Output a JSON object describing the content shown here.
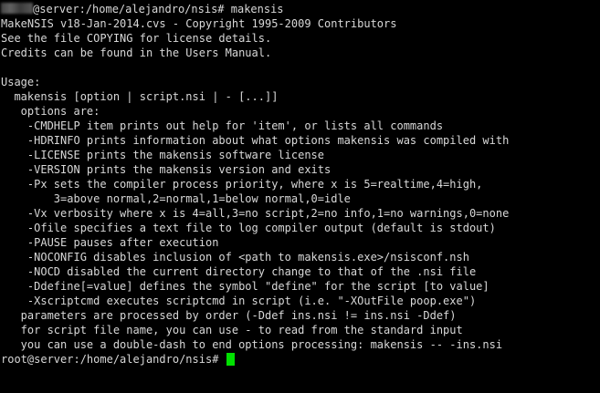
{
  "terminal": {
    "first_prompt": "@server:/home/alejandro/nsis# makensis",
    "output": [
      "MakeNSIS v18-Jan-2014.cvs - Copyright 1995-2009 Contributors",
      "See the file COPYING for license details.",
      "Credits can be found in the Users Manual.",
      "",
      "Usage:",
      "  makensis [option | script.nsi | - [...]]",
      "   options are:",
      "    -CMDHELP item prints out help for 'item', or lists all commands",
      "    -HDRINFO prints information about what options makensis was compiled with",
      "    -LICENSE prints the makensis software license",
      "    -VERSION prints the makensis version and exits",
      "    -Px sets the compiler process priority, where x is 5=realtime,4=high,",
      "        3=above normal,2=normal,1=below normal,0=idle",
      "    -Vx verbosity where x is 4=all,3=no script,2=no info,1=no warnings,0=none",
      "    -Ofile specifies a text file to log compiler output (default is stdout)",
      "    -PAUSE pauses after execution",
      "    -NOCONFIG disables inclusion of <path to makensis.exe>/nsisconf.nsh",
      "    -NOCD disabled the current directory change to that of the .nsi file",
      "    -Ddefine[=value] defines the symbol \"define\" for the script [to value]",
      "    -Xscriptcmd executes scriptcmd in script (i.e. \"-XOutFile poop.exe\")",
      "   parameters are processed by order (-Ddef ins.nsi != ins.nsi -Ddef)",
      "   for script file name, you can use - to read from the standard input",
      "   you can use a double-dash to end options processing: makensis -- -ins.nsi"
    ],
    "last_prompt": "root@server:/home/alejandro/nsis# ",
    "colors": {
      "background": "#000000",
      "text": "#d8d8d8",
      "cursor": "#00e000"
    }
  }
}
